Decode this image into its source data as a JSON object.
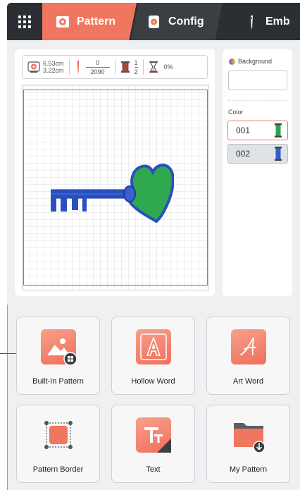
{
  "tabs": [
    {
      "label": "Pattern",
      "icon": "flower-frame-icon",
      "active": true
    },
    {
      "label": "Config",
      "icon": "flower-phone-icon",
      "active": false
    },
    {
      "label": "Emb",
      "icon": "needle-icon",
      "active": false
    }
  ],
  "info": {
    "width": "6.53cm",
    "height": "3.22cm",
    "stitch_current": "0",
    "stitch_total": "2090",
    "color_current": "1",
    "color_total": "2",
    "progress": "0%"
  },
  "side_panel": {
    "background_label": "Background",
    "color_label": "Color",
    "colors": [
      {
        "id": "001",
        "thread_color": "#2aa84a"
      },
      {
        "id": "002",
        "thread_color": "#2f5fd0"
      }
    ]
  },
  "features": [
    {
      "label": "Built-In Pattern",
      "icon": "image-grid-icon"
    },
    {
      "label": "Hollow Word",
      "icon": "hollow-letter-a-icon"
    },
    {
      "label": "Art Word",
      "icon": "script-letter-a-icon"
    },
    {
      "label": "Pattern Border",
      "icon": "border-frame-icon"
    },
    {
      "label": "Text",
      "icon": "text-tt-icon"
    },
    {
      "label": "My Pattern",
      "icon": "folder-download-icon"
    }
  ],
  "theme": {
    "accent": "#f07660",
    "topbar": "#2b2f33"
  }
}
